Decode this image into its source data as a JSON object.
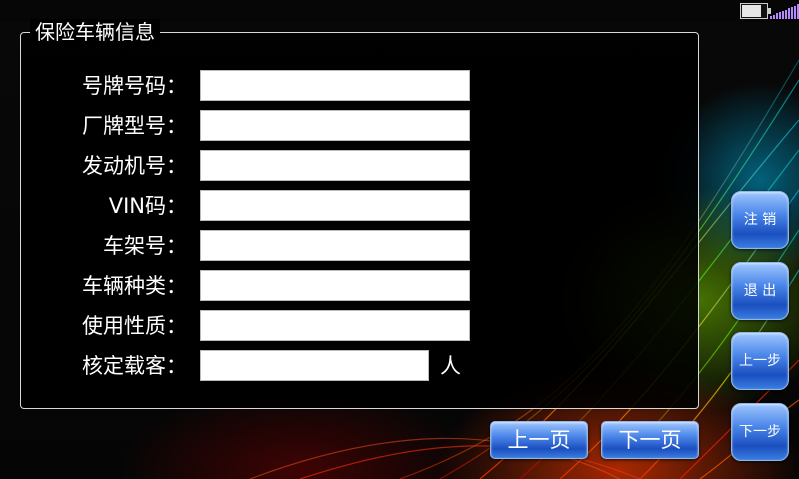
{
  "status_bar": {
    "battery_icon": "battery-icon",
    "battery_level": 0.8,
    "signal_icon": "signal-strength-icon",
    "accent": "#b28bff"
  },
  "panel": {
    "title": "保险车辆信息",
    "fields": [
      {
        "label": "号牌号码：",
        "value": ""
      },
      {
        "label": "厂牌型号：",
        "value": ""
      },
      {
        "label": "发动机号：",
        "value": ""
      },
      {
        "label": "VIN码：",
        "value": ""
      },
      {
        "label": "车架号：",
        "value": ""
      },
      {
        "label": "车辆种类：",
        "value": ""
      },
      {
        "label": "使用性质：",
        "value": ""
      },
      {
        "label": "核定载客：",
        "value": "",
        "unit": "人"
      }
    ]
  },
  "pager": {
    "prev_label": "上一页",
    "next_label": "下一页"
  },
  "side_buttons": {
    "logout_label": "注 销",
    "exit_label": "退 出",
    "prev_step_label": "上一步",
    "next_step_label": "下一步"
  },
  "colors": {
    "button_blue": "#3a7de0",
    "field_bg": "#ffffff",
    "text": "#ffffff"
  }
}
